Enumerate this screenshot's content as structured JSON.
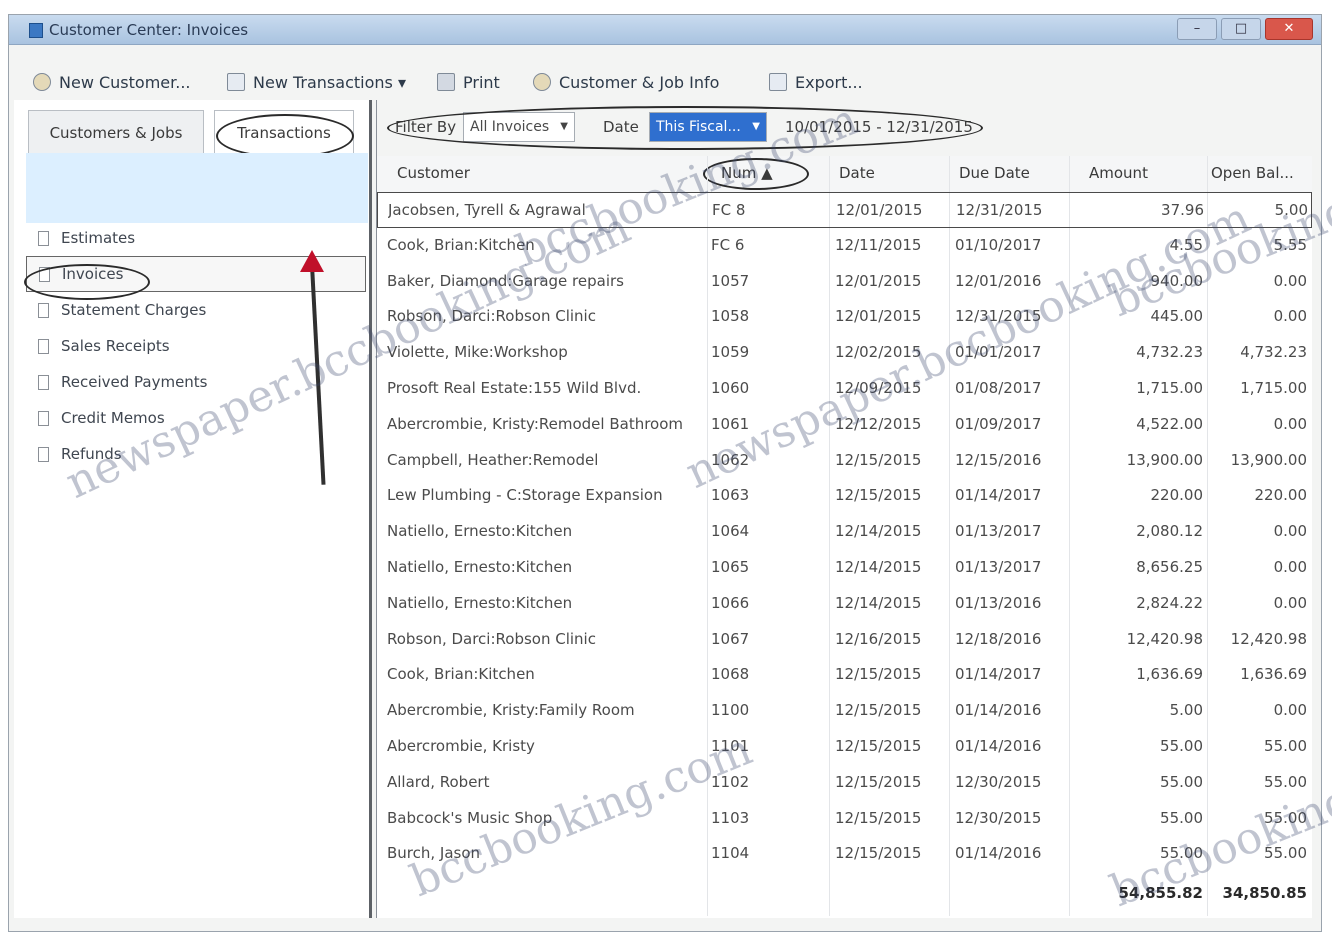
{
  "window": {
    "title": "Customer Center: Invoices",
    "minimize": "–",
    "maximize": "□",
    "close": "✕"
  },
  "toolbar": {
    "new_customer": "New Customer...",
    "new_transactions": "New Transactions ▾",
    "print": "Print",
    "customer_job_info": "Customer & Job Info",
    "export": "Export..."
  },
  "left_tabs": {
    "customers_jobs": "Customers & Jobs",
    "transactions": "Transactions"
  },
  "nav_items": [
    "Estimates",
    "Invoices",
    "Statement Charges",
    "Sales Receipts",
    "Received Payments",
    "Credit Memos",
    "Refunds"
  ],
  "filter": {
    "filter_by_label": "Filter By",
    "filter_by_value": "All Invoices",
    "date_label": "Date",
    "date_value": "This Fiscal...",
    "date_range": "10/01/2015 - 12/31/2015"
  },
  "columns": {
    "customer": "Customer",
    "num": "Num ▲",
    "date": "Date",
    "due_date": "Due Date",
    "amount": "Amount",
    "open_balance": "Open Bal..."
  },
  "rows": [
    {
      "customer": "Jacobsen, Tyrell & Agrawal",
      "num": "FC 8",
      "date": "12/01/2015",
      "due_date": "12/31/2015",
      "amount": "37.96",
      "open": "5.00"
    },
    {
      "customer": "Cook, Brian:Kitchen",
      "num": "FC 6",
      "date": "12/11/2015",
      "due_date": "01/10/2017",
      "amount": "4.55",
      "open": "5.55"
    },
    {
      "customer": "Baker, Diamond:Garage repairs",
      "num": "1057",
      "date": "12/01/2015",
      "due_date": "12/01/2016",
      "amount": "940.00",
      "open": "0.00"
    },
    {
      "customer": "Robson, Darci:Robson Clinic",
      "num": "1058",
      "date": "12/01/2015",
      "due_date": "12/31/2015",
      "amount": "445.00",
      "open": "0.00"
    },
    {
      "customer": "Violette, Mike:Workshop",
      "num": "1059",
      "date": "12/02/2015",
      "due_date": "01/01/2017",
      "amount": "4,732.23",
      "open": "4,732.23"
    },
    {
      "customer": "Prosoft Real Estate:155 Wild Blvd.",
      "num": "1060",
      "date": "12/09/2015",
      "due_date": "01/08/2017",
      "amount": "1,715.00",
      "open": "1,715.00"
    },
    {
      "customer": "Abercrombie, Kristy:Remodel Bathroom",
      "num": "1061",
      "date": "12/12/2015",
      "due_date": "01/09/2017",
      "amount": "4,522.00",
      "open": "0.00"
    },
    {
      "customer": "Campbell, Heather:Remodel",
      "num": "1062",
      "date": "12/15/2015",
      "due_date": "12/15/2016",
      "amount": "13,900.00",
      "open": "13,900.00"
    },
    {
      "customer": "Lew Plumbing - C:Storage Expansion",
      "num": "1063",
      "date": "12/15/2015",
      "due_date": "01/14/2017",
      "amount": "220.00",
      "open": "220.00"
    },
    {
      "customer": "Natiello, Ernesto:Kitchen",
      "num": "1064",
      "date": "12/14/2015",
      "due_date": "01/13/2017",
      "amount": "2,080.12",
      "open": "0.00"
    },
    {
      "customer": "Natiello, Ernesto:Kitchen",
      "num": "1065",
      "date": "12/14/2015",
      "due_date": "01/13/2017",
      "amount": "8,656.25",
      "open": "0.00"
    },
    {
      "customer": "Natiello, Ernesto:Kitchen",
      "num": "1066",
      "date": "12/14/2015",
      "due_date": "01/13/2016",
      "amount": "2,824.22",
      "open": "0.00"
    },
    {
      "customer": "Robson, Darci:Robson Clinic",
      "num": "1067",
      "date": "12/16/2015",
      "due_date": "12/18/2016",
      "amount": "12,420.98",
      "open": "12,420.98"
    },
    {
      "customer": "Cook, Brian:Kitchen",
      "num": "1068",
      "date": "12/15/2015",
      "due_date": "01/14/2017",
      "amount": "1,636.69",
      "open": "1,636.69"
    },
    {
      "customer": "Abercrombie, Kristy:Family Room",
      "num": "1100",
      "date": "12/15/2015",
      "due_date": "01/14/2016",
      "amount": "5.00",
      "open": "0.00"
    },
    {
      "customer": "Abercrombie, Kristy",
      "num": "1101",
      "date": "12/15/2015",
      "due_date": "01/14/2016",
      "amount": "55.00",
      "open": "55.00"
    },
    {
      "customer": "Allard, Robert",
      "num": "1102",
      "date": "12/15/2015",
      "due_date": "12/30/2015",
      "amount": "55.00",
      "open": "55.00"
    },
    {
      "customer": "Babcock's Music Shop",
      "num": "1103",
      "date": "12/15/2015",
      "due_date": "12/30/2015",
      "amount": "55.00",
      "open": "55.00"
    },
    {
      "customer": "Burch, Jason",
      "num": "1104",
      "date": "12/15/2015",
      "due_date": "01/14/2016",
      "amount": "55.00",
      "open": "55.00"
    }
  ],
  "totals": {
    "amount": "54,855.82",
    "open": "34,850.85"
  },
  "watermarks": [
    "bccbooking.com",
    "newspaper.bccbooking.com",
    "newspaper.bccbooking.com",
    "bccbooking.com",
    "bccbooking.com",
    "bccbooking.com"
  ]
}
